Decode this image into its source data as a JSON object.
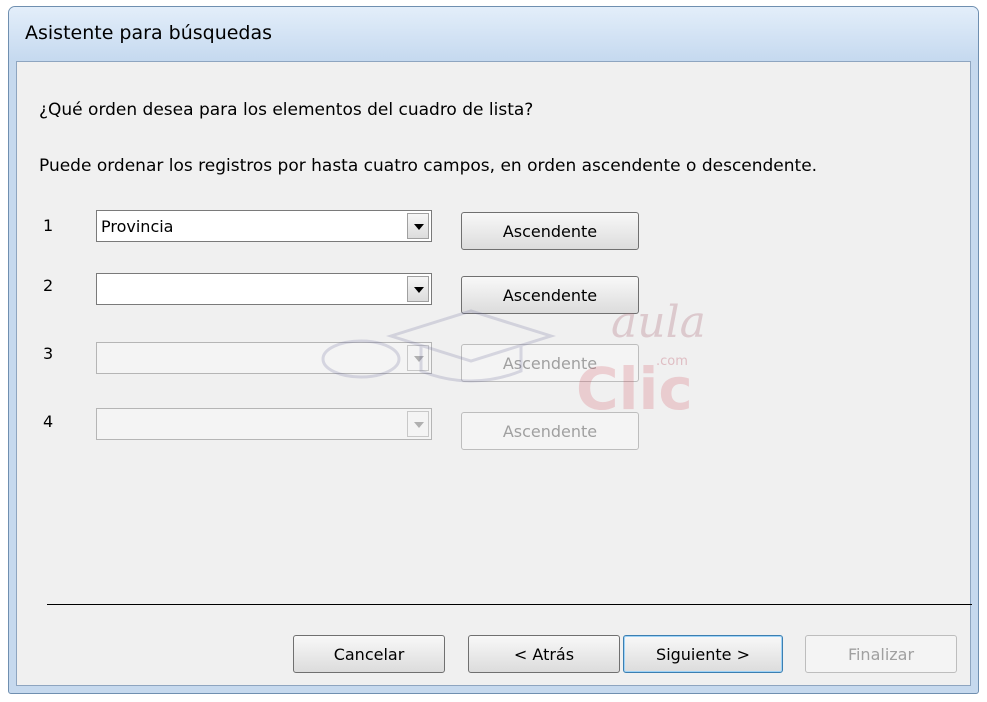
{
  "window": {
    "title": "Asistente para búsquedas"
  },
  "question": "¿Qué orden desea para los elementos del cuadro de lista?",
  "instructions": "Puede ordenar los registros por hasta cuatro campos, en orden ascendente o descendente.",
  "sort_rows": [
    {
      "number": "1",
      "field": "Provincia",
      "order": "Ascendente",
      "enabled": true
    },
    {
      "number": "2",
      "field": "",
      "order": "Ascendente",
      "enabled": true
    },
    {
      "number": "3",
      "field": "",
      "order": "Ascendente",
      "enabled": false
    },
    {
      "number": "4",
      "field": "",
      "order": "Ascendente",
      "enabled": false
    }
  ],
  "watermark": {
    "line1": "aula",
    "line2": "Clic",
    "suffix": ".com"
  },
  "footer": {
    "cancel": "Cancelar",
    "back": "< Atrás",
    "next": "Siguiente >",
    "finish": "Finalizar"
  }
}
